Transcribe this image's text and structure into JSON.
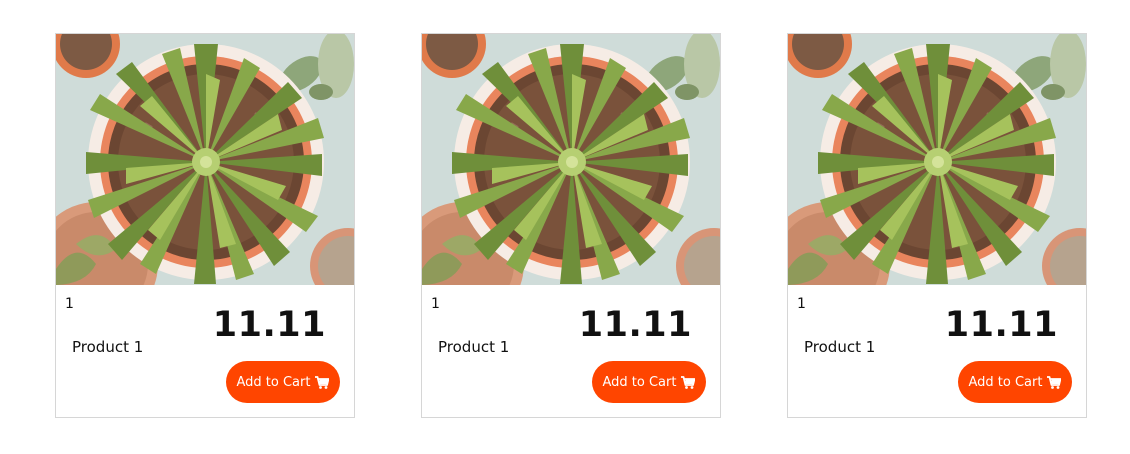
{
  "colors": {
    "accent": "#ff4500",
    "card_border": "#d6d6d6",
    "text": "#111111"
  },
  "products": [
    {
      "id": "1",
      "name": "Product 1",
      "price": "11.11",
      "button_label": "Add to Cart",
      "button_icon": "cart-icon",
      "image": "succulent-plant-in-pot"
    },
    {
      "id": "1",
      "name": "Product 1",
      "price": "11.11",
      "button_label": "Add to Cart",
      "button_icon": "cart-icon",
      "image": "succulent-plant-in-pot"
    },
    {
      "id": "1",
      "name": "Product 1",
      "price": "11.11",
      "button_label": "Add to Cart",
      "button_icon": "cart-icon",
      "image": "succulent-plant-in-pot"
    }
  ]
}
